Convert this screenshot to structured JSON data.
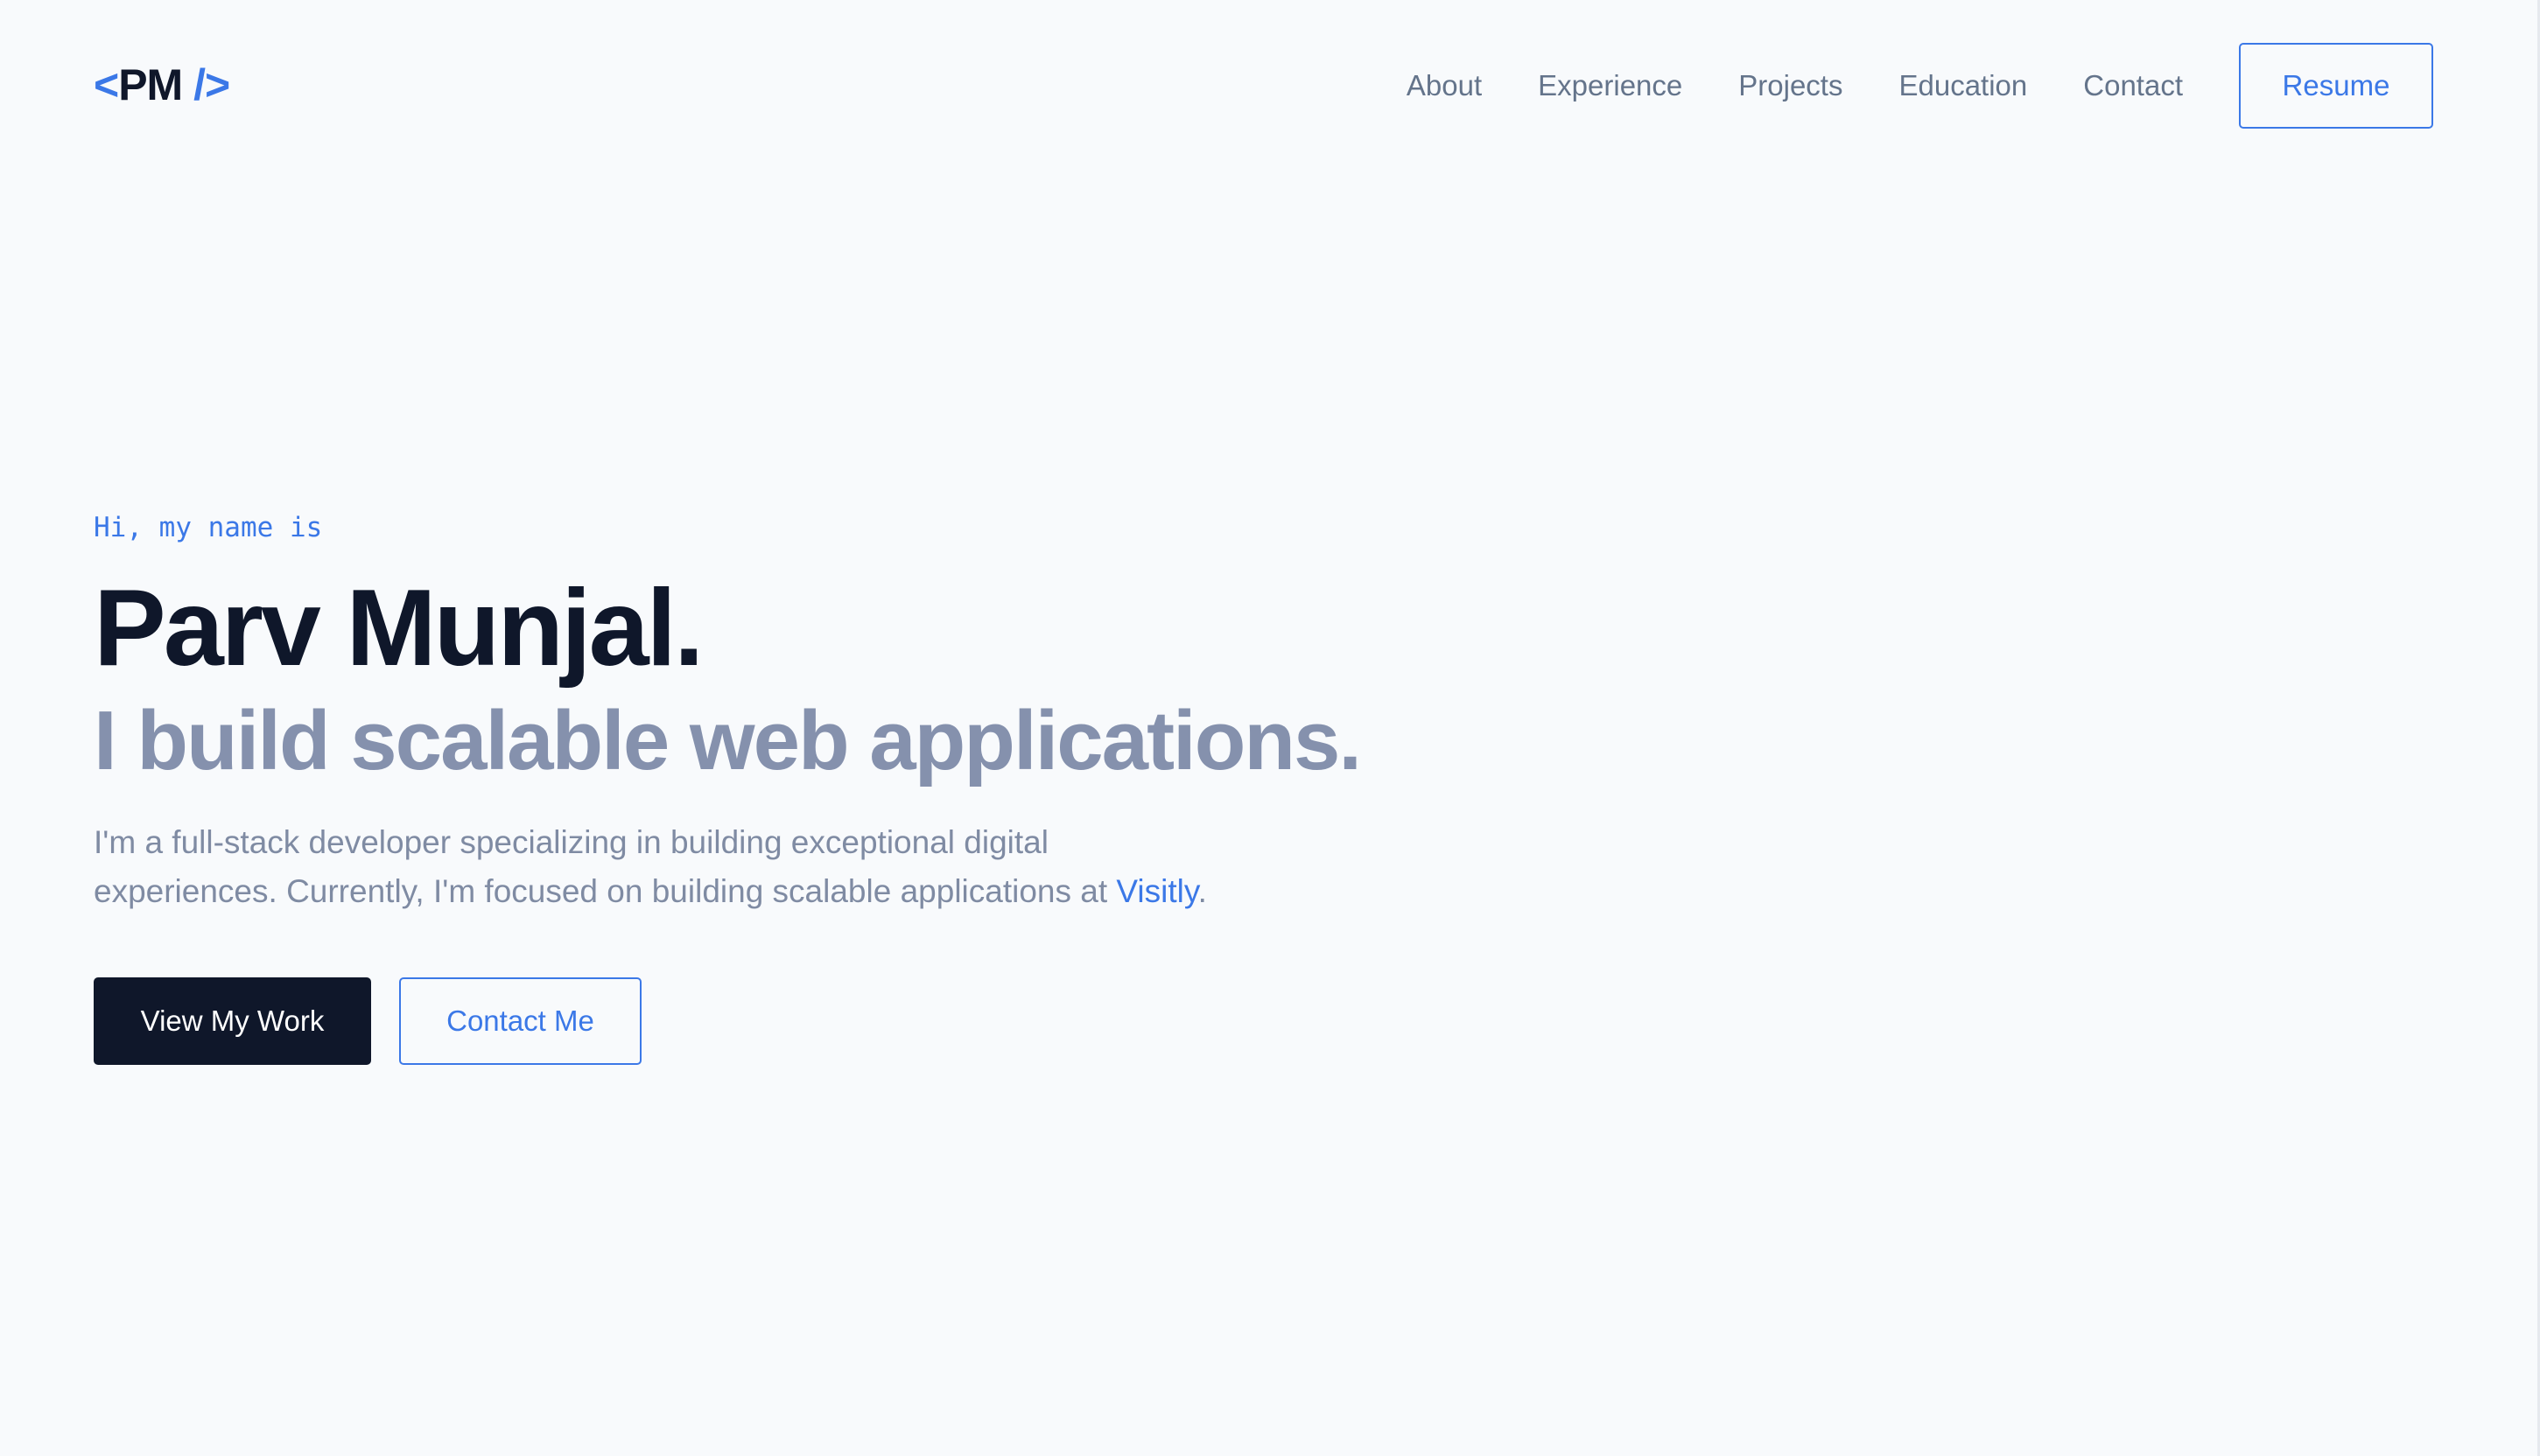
{
  "header": {
    "logo": {
      "open_bracket": "<",
      "initials": "PM",
      "close_bracket": " />"
    },
    "nav": [
      {
        "label": "About"
      },
      {
        "label": "Experience"
      },
      {
        "label": "Projects"
      },
      {
        "label": "Education"
      },
      {
        "label": "Contact"
      }
    ],
    "resume_label": "Resume"
  },
  "hero": {
    "greeting": "Hi, my name is",
    "name": "Parv Munjal.",
    "tagline": "I build scalable web applications.",
    "bio_text": "I'm a full-stack developer specializing in building exceptional digital experiences. Currently, I'm focused on building scalable applications at ",
    "bio_company": "Visitly",
    "bio_end": ".",
    "primary_cta": "View My Work",
    "secondary_cta": "Contact Me"
  },
  "colors": {
    "accent": "#3b78e7",
    "dark": "#0f172a",
    "muted": "#64748b",
    "background": "#f8fafc"
  }
}
